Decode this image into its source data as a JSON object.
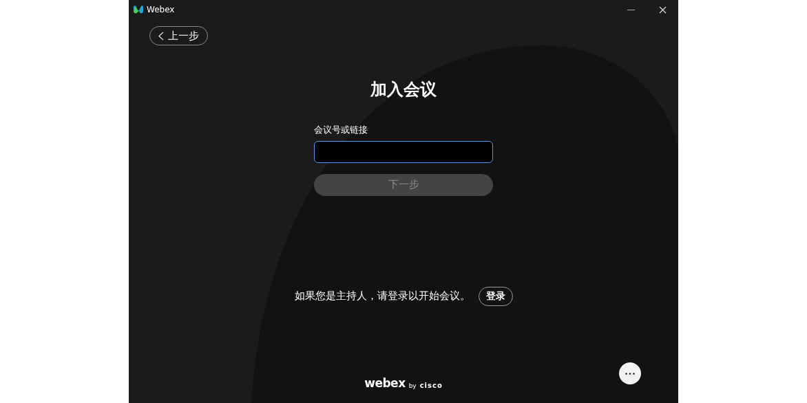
{
  "window": {
    "title": "Webex"
  },
  "back_button": {
    "label": "上一步"
  },
  "heading": "加入会议",
  "meeting_field": {
    "label": "会议号或链接",
    "focused": true
  },
  "next_button": {
    "label": "下一步",
    "disabled": true
  },
  "host_prompt": {
    "text": "如果您是主持人，请登录以开始会议。",
    "sign_in": "登录"
  },
  "footer": {
    "brand": "webex",
    "by": "by",
    "company": "cisco"
  }
}
